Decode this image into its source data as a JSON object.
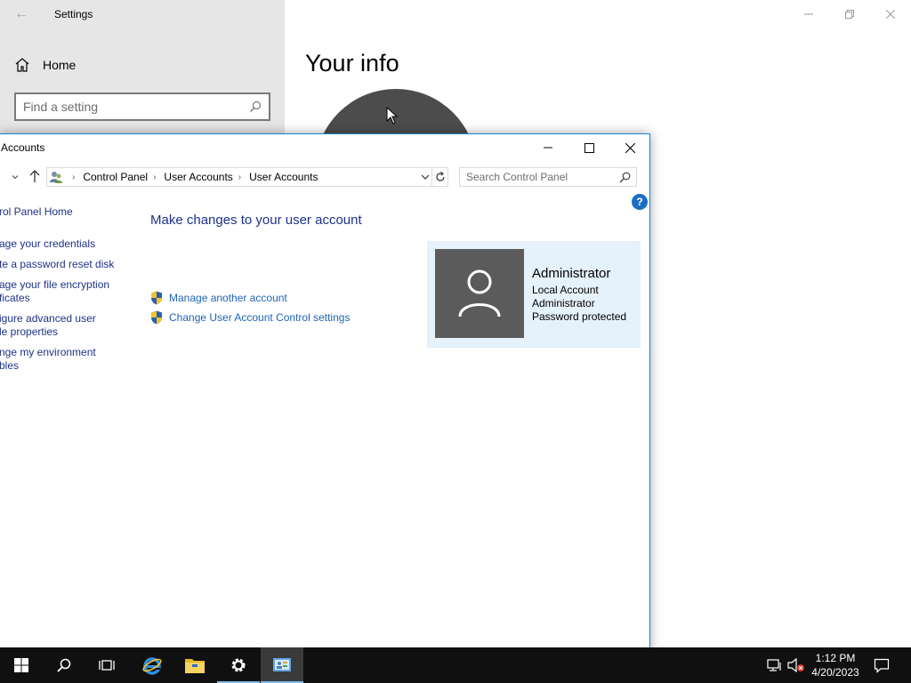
{
  "settings": {
    "title": "Settings",
    "home_label": "Home",
    "search_placeholder": "Find a setting",
    "page_heading": "Your info"
  },
  "control_panel": {
    "title": "Accounts",
    "breadcrumb": [
      "Control Panel",
      "User Accounts",
      "User Accounts"
    ],
    "search_placeholder": "Search Control Panel",
    "help_label": "?",
    "left_nav": [
      {
        "lines": [
          "rol Panel Home"
        ]
      },
      {
        "lines": [
          "age your credentials"
        ]
      },
      {
        "lines": [
          "te a password reset disk"
        ]
      },
      {
        "lines": [
          "age your file encryption",
          "ficates"
        ]
      },
      {
        "lines": [
          "igure advanced user",
          "le properties"
        ]
      },
      {
        "lines": [
          "nge my environment",
          "bles"
        ]
      }
    ],
    "heading": "Make changes to your user account",
    "tasks": [
      {
        "label": "Manage another account",
        "icon": "shield-icon"
      },
      {
        "label": "Change User Account Control settings",
        "icon": "shield-icon"
      }
    ],
    "account": {
      "name": "Administrator",
      "type": "Local Account",
      "group": "Administrator",
      "status": "Password protected"
    }
  },
  "taskbar": {
    "apps": [
      "windows-start-icon",
      "search-icon",
      "task-view-icon",
      "internet-explorer-icon",
      "file-explorer-icon",
      "settings-gear-icon",
      "control-panel-icon"
    ],
    "tray": [
      "network-icon",
      "volume-muted-icon",
      "notification-icon"
    ],
    "time": "1:12 PM",
    "date": "4/20/2023"
  },
  "colors": {
    "link": "#1e64b4",
    "heading": "#1e3287",
    "card_bg": "#e5f1fb",
    "accent": "#1883d7",
    "taskbar": "#101010"
  }
}
